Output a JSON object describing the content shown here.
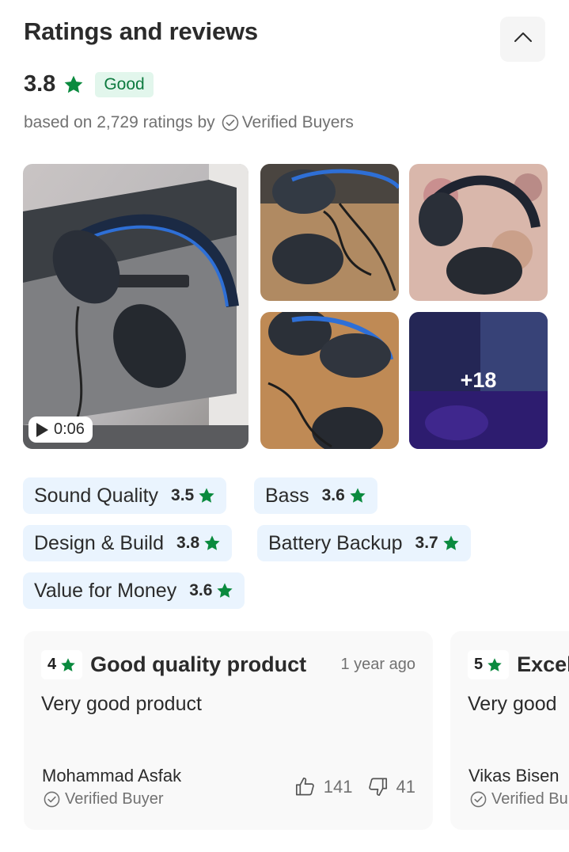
{
  "header": {
    "title": "Ratings and reviews"
  },
  "summary": {
    "rating": "3.8",
    "badge": "Good",
    "based_on_prefix": "based on 2,729 ratings by",
    "verified_label": "Verified Buyers"
  },
  "gallery": {
    "video_duration": "0:06",
    "more_count": "+18"
  },
  "aspects": [
    {
      "label": "Sound Quality",
      "score": "3.5"
    },
    {
      "label": "Bass",
      "score": "3.6"
    },
    {
      "label": "Design & Build",
      "score": "3.8"
    },
    {
      "label": "Battery Backup",
      "score": "3.7"
    },
    {
      "label": "Value for Money",
      "score": "3.6"
    }
  ],
  "reviews": [
    {
      "rating": "4",
      "title": "Good quality product",
      "time": "1 year ago",
      "body": "Very good product",
      "author": "Mohammad  Asfak",
      "verified": "Verified Buyer",
      "likes": "141",
      "dislikes": "41"
    },
    {
      "rating": "5",
      "title": "Excel",
      "body": "Very good",
      "author": "Vikas Bisen",
      "verified": "Verified Bu"
    }
  ],
  "colors": {
    "star_green": "#0a8a3e",
    "badge_bg": "#e2f6ec",
    "chip_bg": "#eaf4fe",
    "card_bg": "#f9f9f9"
  }
}
